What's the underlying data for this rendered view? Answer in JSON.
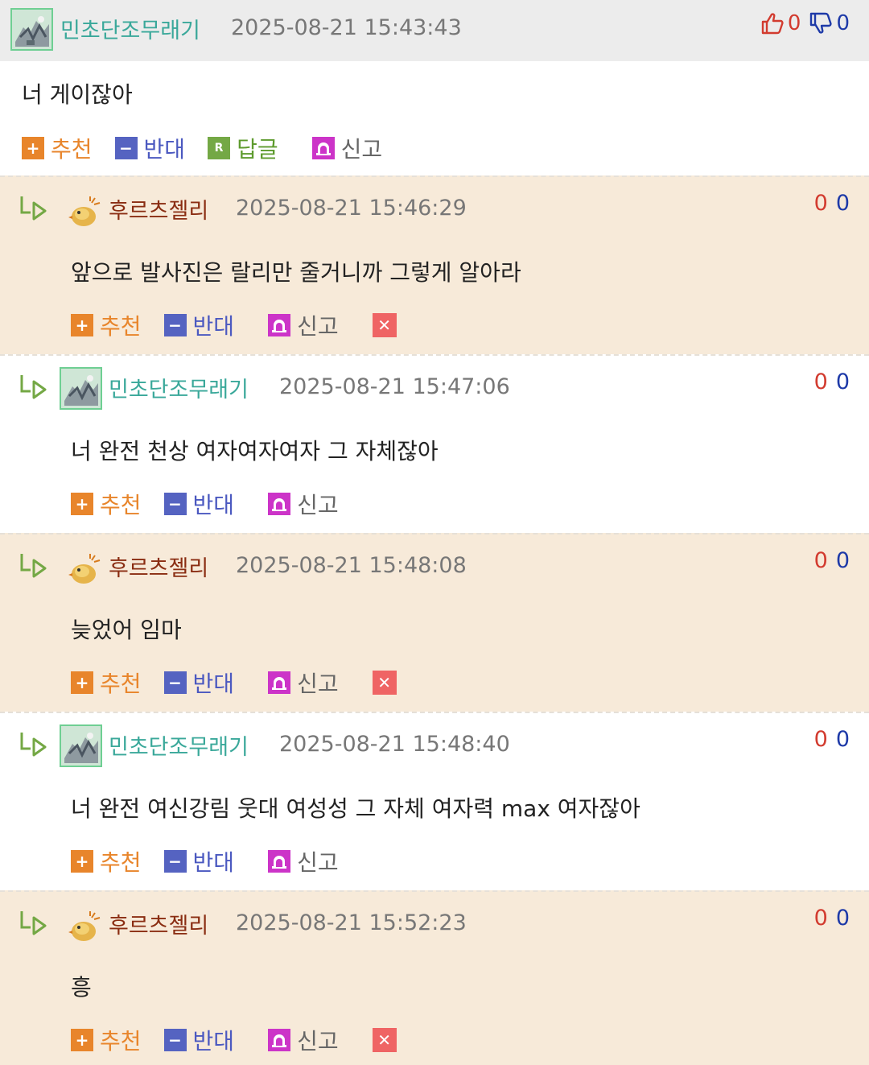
{
  "parent": {
    "nickname": "민초단조무래기",
    "date": "2025-08-21 15:43:43",
    "up_count": "0",
    "down_count": "0",
    "text": "너 게이잖아",
    "actions": {
      "recommend": "추천",
      "oppose": "반대",
      "reply": "답글",
      "report": "신고"
    }
  },
  "actions": {
    "recommend": "추천",
    "oppose": "반대",
    "report": "신고"
  },
  "replies": [
    {
      "nickname": "후르츠젤리",
      "date": "2025-08-21 15:46:29",
      "up": "0",
      "down": "0",
      "text": "앞으로 발사진은 랄리만 줄거니까 그렇게 알아라"
    },
    {
      "nickname": "민초단조무래기",
      "date": "2025-08-21 15:47:06",
      "up": "0",
      "down": "0",
      "text": "너 완전 천상 여자여자여자 그 자체잖아"
    },
    {
      "nickname": "후르츠젤리",
      "date": "2025-08-21 15:48:08",
      "up": "0",
      "down": "0",
      "text": "늦었어 임마"
    },
    {
      "nickname": "민초단조무래기",
      "date": "2025-08-21 15:48:40",
      "up": "0",
      "down": "0",
      "text": "너 완전 여신강림 웃대 여성성 그 자체 여자력 max 여자잖아"
    },
    {
      "nickname": "후르츠젤리",
      "date": "2025-08-21 15:52:23",
      "up": "0",
      "down": "0",
      "text": "흥"
    }
  ],
  "icons": {
    "thumbs_up": "thumbs-up-icon",
    "thumbs_down": "thumbs-down-icon",
    "reply_arrow": "reply-arrow-icon",
    "plus": "plus-icon",
    "minus": "minus-icon",
    "reply_badge": "reply-badge-icon",
    "report": "siren-icon",
    "delete": "close-icon"
  },
  "colors": {
    "header_bg": "#ececec",
    "reply_beige": "#f7ead9",
    "nick_mint": "#3aa89a",
    "nick_brown": "#8a2d12",
    "recommend": "#e8852b",
    "oppose": "#4b59c0",
    "reply": "#5e9b2e",
    "report": "#cc34c8",
    "delete": "#ef6464",
    "up": "#d23b2f",
    "down": "#1e3aa8"
  }
}
